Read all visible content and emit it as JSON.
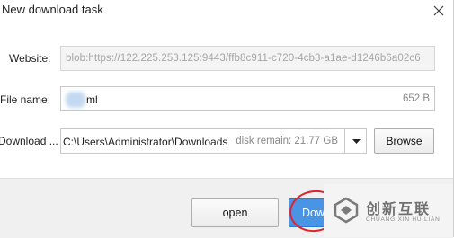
{
  "window": {
    "title": "New download task"
  },
  "form": {
    "website_label": "Website:",
    "website_value": "blob:https://122.225.253.125:9443/ffb8c911-c720-4cb3-a1ae-d1246b6a02c6",
    "filename_label": "File name:",
    "filename_value": "ml",
    "file_size": "652 B",
    "download_label": "Download ...",
    "download_path": "C:\\Users\\Administrator\\Downloads",
    "disk_remain": "disk remain: 21.77 GB",
    "browse_label": "Browse"
  },
  "footer": {
    "open_label": "open",
    "download_label": "Download"
  },
  "watermark": {
    "name": "创新互联",
    "sub": "CHUANG XIN HU LIAN"
  },
  "colors": {
    "accent": "#4a94e6",
    "highlight_circle": "#e3202a"
  }
}
